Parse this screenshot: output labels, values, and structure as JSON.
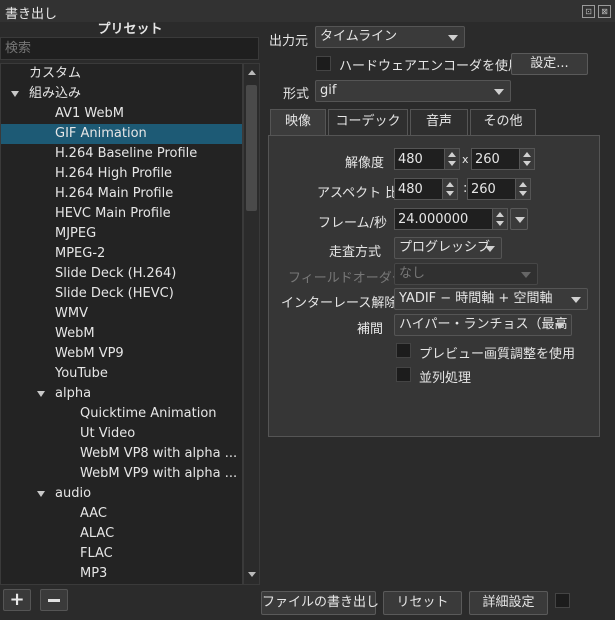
{
  "window": {
    "title": "書き出し",
    "float_icon": "⊡",
    "close_icon": "⊠"
  },
  "presets": {
    "header": "プリセット",
    "search_placeholder": "検索",
    "items": [
      {
        "label": "カスタム",
        "level": 0,
        "expandable": false
      },
      {
        "label": "組み込み",
        "level": 0,
        "expandable": true
      },
      {
        "label": "AV1 WebM",
        "level": 1
      },
      {
        "label": "GIF Animation",
        "level": 1,
        "selected": true
      },
      {
        "label": "H.264 Baseline Profile",
        "level": 1
      },
      {
        "label": "H.264 High Profile",
        "level": 1
      },
      {
        "label": "H.264 Main Profile",
        "level": 1
      },
      {
        "label": "HEVC Main Profile",
        "level": 1
      },
      {
        "label": "MJPEG",
        "level": 1
      },
      {
        "label": "MPEG-2",
        "level": 1
      },
      {
        "label": "Slide Deck (H.264)",
        "level": 1
      },
      {
        "label": "Slide Deck (HEVC)",
        "level": 1
      },
      {
        "label": "WMV",
        "level": 1
      },
      {
        "label": "WebM",
        "level": 1
      },
      {
        "label": "WebM VP9",
        "level": 1
      },
      {
        "label": "YouTube",
        "level": 1
      },
      {
        "label": "alpha",
        "level": 1,
        "expandable": true
      },
      {
        "label": "Quicktime Animation",
        "level": 2
      },
      {
        "label": "Ut Video",
        "level": 2
      },
      {
        "label": "WebM VP8 with alpha ...",
        "level": 2
      },
      {
        "label": "WebM VP9 with alpha ...",
        "level": 2
      },
      {
        "label": "audio",
        "level": 1,
        "expandable": true
      },
      {
        "label": "AAC",
        "level": 2
      },
      {
        "label": "ALAC",
        "level": 2
      },
      {
        "label": "FLAC",
        "level": 2
      },
      {
        "label": "MP3",
        "level": 2
      }
    ],
    "add_label": "+",
    "remove_label": "−"
  },
  "output": {
    "source_label": "出力元",
    "source_value": "タイムライン",
    "hw_encoder_label": "ハードウェアエンコーダを使用",
    "settings_button": "設定...",
    "format_label": "形式",
    "format_value": "gif"
  },
  "tabs": [
    "映像",
    "コーデック",
    "音声",
    "その他"
  ],
  "video": {
    "resolution_label": "解像度",
    "width": "480",
    "height": "260",
    "times": "x",
    "aspect_label": "アスペクト 比",
    "aspect_w": "480",
    "aspect_h": "260",
    "colon": ":",
    "fps_label": "フレーム/秒",
    "fps": "24.000000",
    "scan_label": "走査方式",
    "scan_value": "プログレッシブ",
    "field_label": "フィールドオーダー",
    "field_value": "なし",
    "deinterlace_label": "インターレース解除",
    "deinterlace_value": "YADIF − 時間軸 + 空間軸",
    "interp_label": "補間",
    "interp_value": "ハイパー・ランチョス（最高",
    "preview_label": "プレビュー画質調整を使用",
    "parallel_label": "並列処理"
  },
  "bottom": {
    "export_button": "ファイルの書き出し",
    "reset_button": "リセット",
    "advanced_button": "詳細設定"
  }
}
